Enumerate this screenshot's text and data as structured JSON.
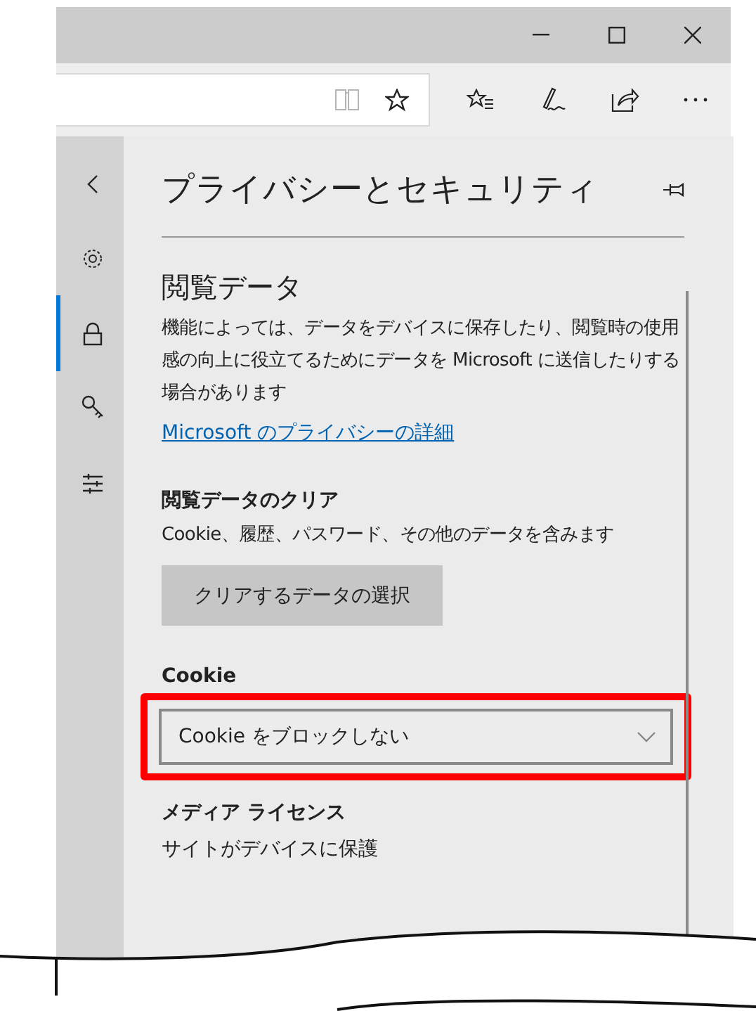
{
  "sidebar": {
    "items": [
      {
        "kind": "back",
        "selected": false
      },
      {
        "kind": "settings",
        "selected": false
      },
      {
        "kind": "privacy",
        "selected": true
      },
      {
        "kind": "passwords",
        "selected": false
      },
      {
        "kind": "advanced",
        "selected": false
      }
    ]
  },
  "panel": {
    "title": "プライバシーとセキュリティ",
    "browsing_data": {
      "heading": "閲覧データ",
      "description": "機能によっては、データをデバイスに保存したり、閲覧時の使用感の向上に役立てるためにデータを Microsoft に送信したりする場合があります",
      "link": "Microsoft のプライバシーの詳細"
    },
    "clear_data": {
      "label": "閲覧データのクリア",
      "description": "Cookie、履歴、パスワード、その他のデータを含みます",
      "button": "クリアするデータの選択"
    },
    "cookie": {
      "label": "Cookie",
      "dropdown": {
        "value": "Cookie をブロックしない",
        "highlighted": true
      }
    },
    "media_license": {
      "label": "メディア ライセンス",
      "description": "サイトがデバイスに保護"
    }
  }
}
